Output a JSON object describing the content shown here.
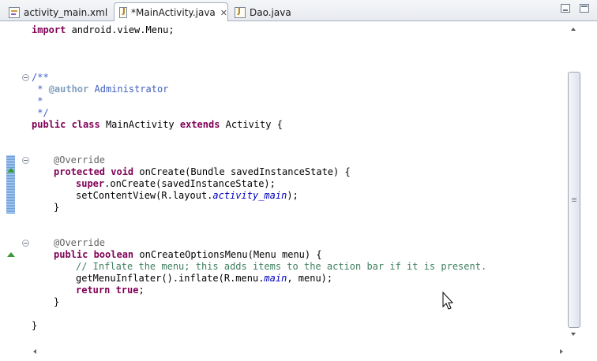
{
  "tabs": [
    {
      "label": "activity_main.xml",
      "icon": "xml-file-icon"
    },
    {
      "label": "*MainActivity.java",
      "icon": "java-file-icon",
      "active": true,
      "close": "✕"
    },
    {
      "label": "Dao.java",
      "icon": "java-file-icon"
    }
  ],
  "code": {
    "import_kw": "import",
    "import_rest": " android.view.Menu;",
    "doc_open": "/**",
    "doc_author_star": " * ",
    "doc_author_tag": "@author",
    "doc_author_name": " Administrator",
    "doc_star": " *",
    "doc_close": " */",
    "class_public": "public",
    "class_class": " class",
    "class_name": " MainActivity ",
    "class_extends": "extends",
    "class_rest": " Activity {",
    "ann1": "@Override",
    "m1_protected": "protected",
    "m1_void": " void",
    "m1_rest": " onCreate(Bundle savedInstanceState) {",
    "m1_super": "super",
    "m1_super_rest": ".onCreate(savedInstanceState);",
    "m1_set": "setContentView(R.layout.",
    "m1_set_field": "activity_main",
    "m1_set_end": ");",
    "m1_close": "}",
    "ann2": "@Override",
    "m2_public": "public",
    "m2_boolean": " boolean",
    "m2_rest": " onCreateOptionsMenu(Menu menu) {",
    "m2_comment": "// Inflate the menu; this adds items to the action bar if it is present.",
    "m2_inflate": "getMenuInflater().inflate(R.menu.",
    "m2_inflate_field": "main",
    "m2_inflate_end": ", menu);",
    "m2_return": "return",
    "m2_true": " true",
    "m2_semi": ";",
    "m2_close": "}",
    "class_close": "}"
  },
  "colors": {
    "keyword": "#7f0055",
    "javadoc": "#3f5fbf",
    "comment": "#3f7f5f",
    "annotation": "#646464",
    "field": "#0000c0"
  }
}
